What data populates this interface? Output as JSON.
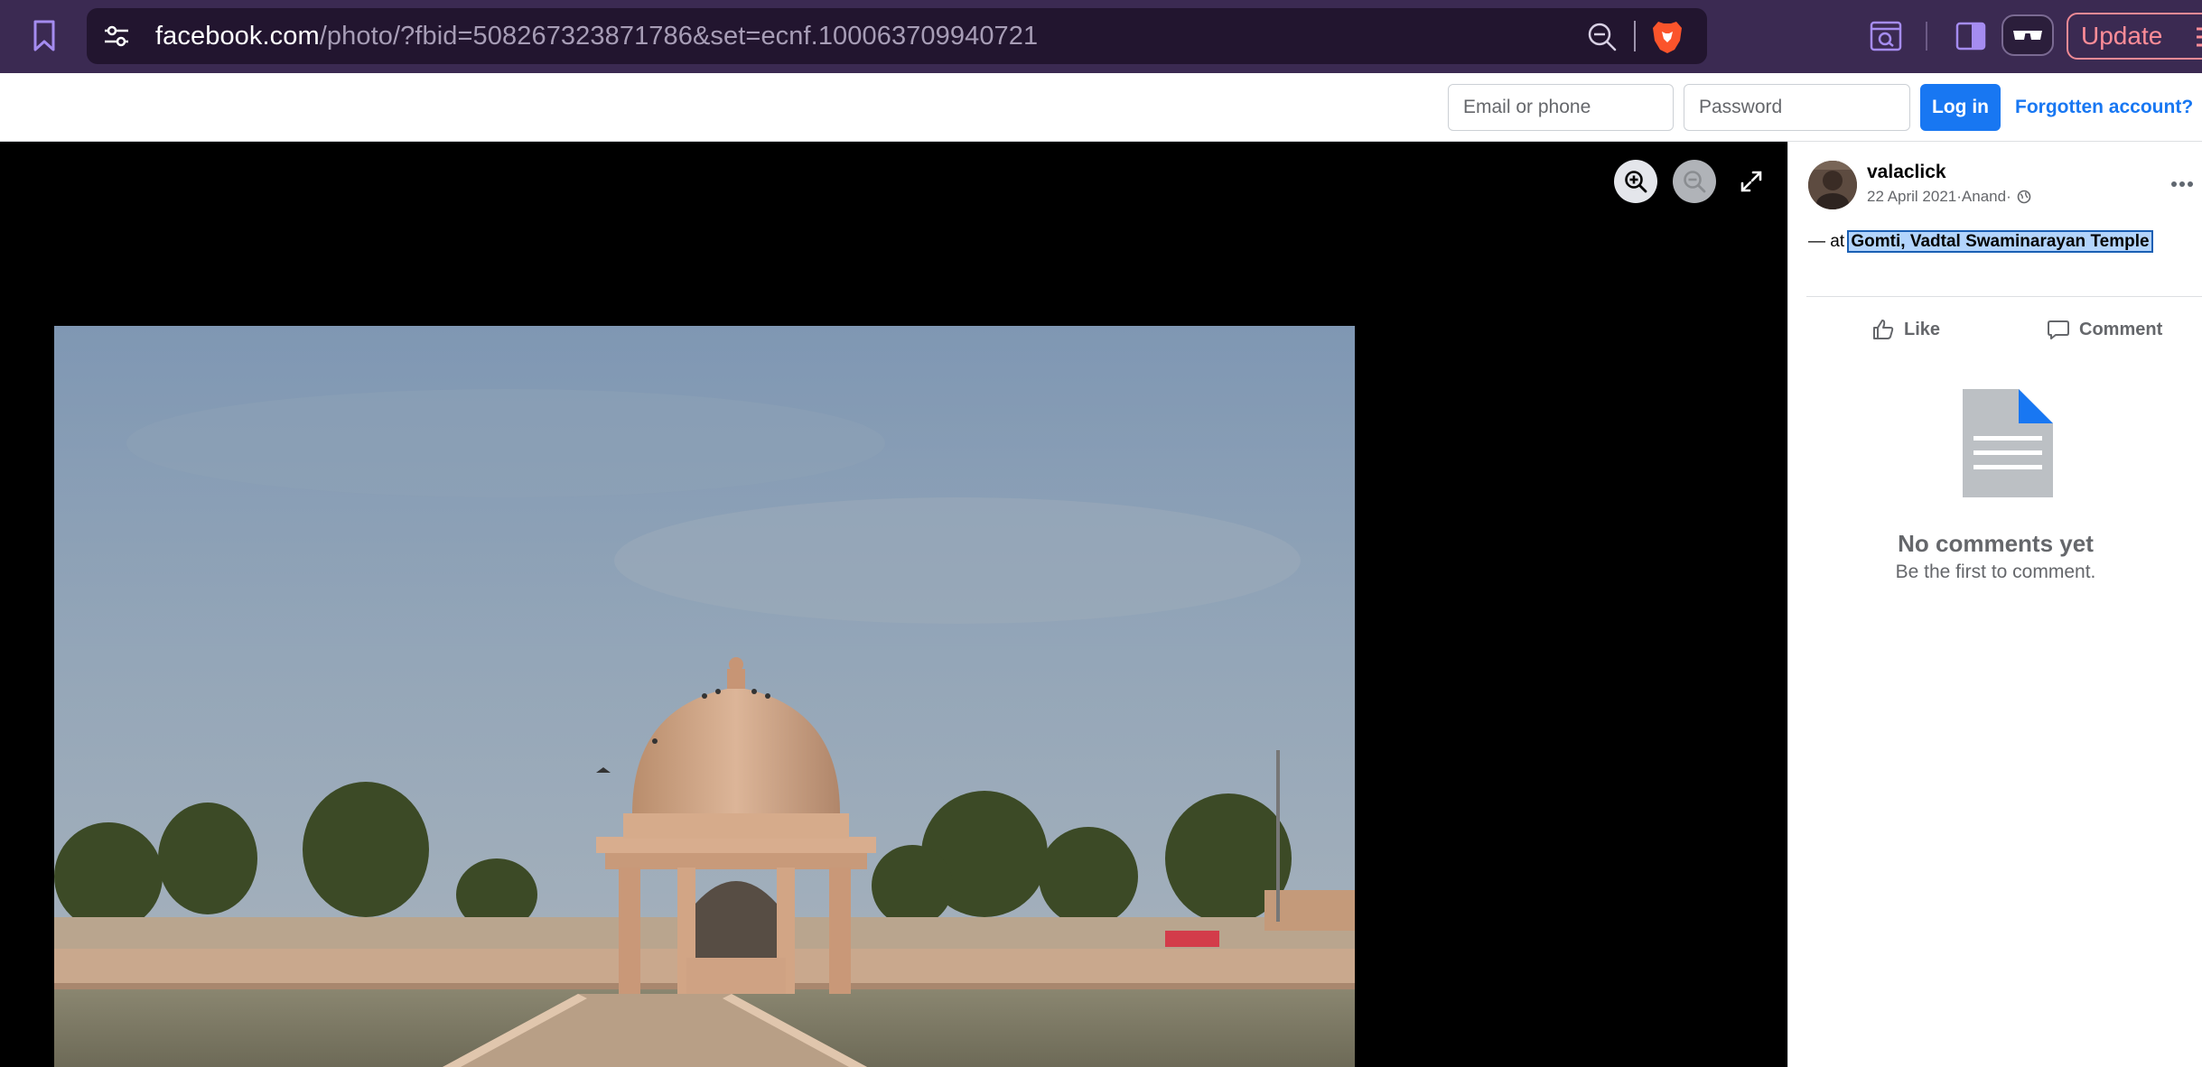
{
  "browser": {
    "url_host": "facebook.com",
    "url_path": "/photo/?fbid=508267323871786&set=ecnf.100063709940721",
    "update_label": "Update",
    "icons": [
      "bookmark-icon",
      "site-settings-icon",
      "zoom-out-icon",
      "brave-lion-icon",
      "reader-mode-icon",
      "sidebar-icon",
      "private-glasses-icon",
      "menu-icon"
    ]
  },
  "fb_header": {
    "email_placeholder": "Email or phone",
    "password_placeholder": "Password",
    "login_label": "Log in",
    "forgot_label": "Forgotten account?"
  },
  "viewer": {
    "controls": [
      "zoom-in-icon",
      "zoom-out-icon",
      "fullscreen-icon"
    ]
  },
  "post": {
    "author": "valaclick",
    "date": "22 April 2021",
    "place": "Anand",
    "separator": " · ",
    "location_prefix": "— at ",
    "location": "Gomti, Vadtal Swaminarayan Temple",
    "like_label": "Like",
    "comment_label": "Comment",
    "no_comments_title": "No comments yet",
    "no_comments_sub": "Be the first to comment."
  },
  "colors": {
    "browser_bar": "#3b2a52",
    "fb_blue": "#1877f2",
    "update_accent": "#ff8d98"
  }
}
